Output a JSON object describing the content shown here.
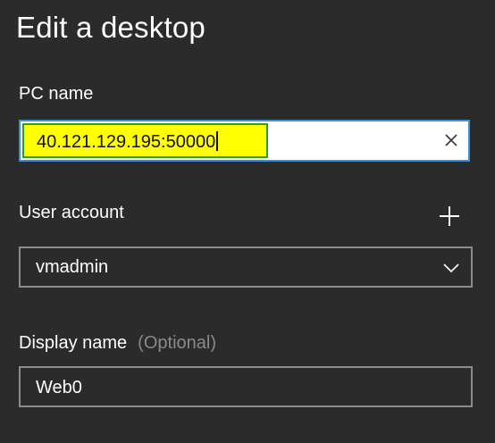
{
  "dialog": {
    "title": "Edit a desktop"
  },
  "pc_name": {
    "label": "PC name",
    "value": "40.121.129.195:50000",
    "highlight_color": "#ffff00",
    "focus_border_color": "#3c8fd4",
    "clear_icon": "close-icon"
  },
  "user_account": {
    "label": "User account",
    "selected": "vmadmin",
    "add_icon": "plus-icon",
    "dropdown_icon": "chevron-down-icon"
  },
  "display_name": {
    "label": "Display name",
    "optional_hint": "(Optional)",
    "value": "Web0"
  },
  "colors": {
    "background": "#2b2b2b",
    "text": "#ffffff",
    "muted": "#8a8a8a",
    "border": "#8c8c8c"
  }
}
